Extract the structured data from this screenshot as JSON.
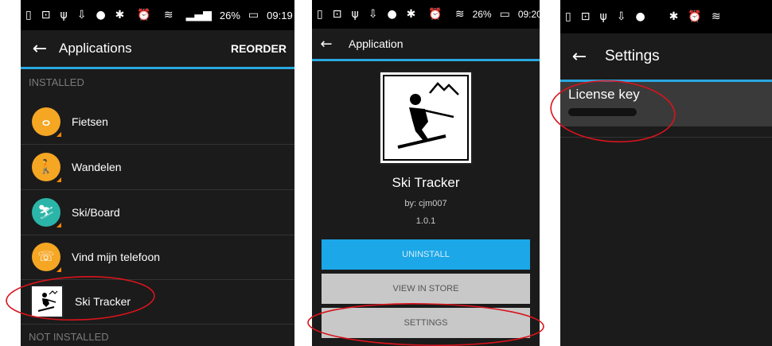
{
  "phone1": {
    "status": {
      "battery": "26%",
      "time": "09:19"
    },
    "toolbar": {
      "title": "Applications",
      "action": "REORDER"
    },
    "installed_header": "INSTALLED",
    "not_installed_header": "NOT INSTALLED",
    "apps": [
      {
        "label": "Fietsen",
        "icon": "bicycle-icon",
        "color": "#f5a623"
      },
      {
        "label": "Wandelen",
        "icon": "walking-icon",
        "color": "#f5a623"
      },
      {
        "label": "Ski/Board",
        "icon": "ski-board-icon",
        "color": "#2bb5a8"
      },
      {
        "label": "Vind mijn telefoon",
        "icon": "phone-icon",
        "color": "#f5a623"
      },
      {
        "label": "Ski Tracker",
        "icon": "ski-tracker-icon",
        "color": "#ffffff"
      }
    ]
  },
  "phone2": {
    "status": {
      "battery": "26%",
      "time": "09:20"
    },
    "toolbar": {
      "title": "Application"
    },
    "app_name": "Ski Tracker",
    "author": "by: cjm007",
    "version": "1.0.1",
    "buttons": {
      "uninstall": "UNINSTALL",
      "view_in_store": "VIEW IN STORE",
      "settings": "SETTINGS"
    }
  },
  "phone3": {
    "toolbar": {
      "title": "Settings"
    },
    "license_key_label": "License key"
  },
  "colors": {
    "accent_blue": "#29a8e0",
    "annotation_red": "#d9141c",
    "button_blue": "#1ba7e8",
    "button_gray": "#c8c8c8"
  }
}
